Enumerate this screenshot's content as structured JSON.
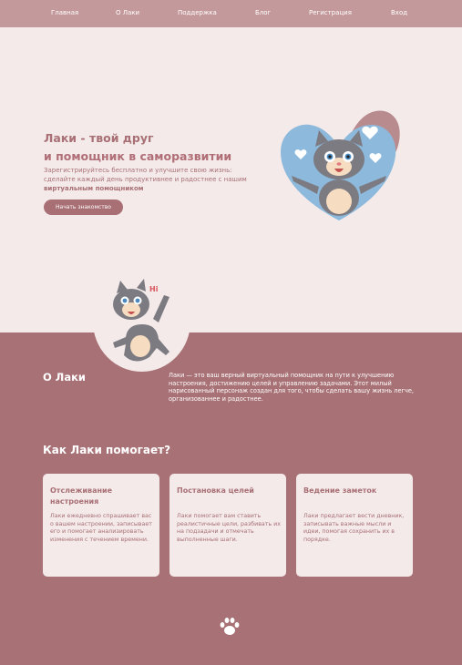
{
  "nav": {
    "items": [
      "Главная",
      "О Лаки",
      "Поддержка",
      "Блог",
      "Регистрация",
      "Вход"
    ]
  },
  "hero": {
    "title_line1": "Лаки - твой друг",
    "title_line2": "и помощник в саморазвитии",
    "subtitle_part1": "Зарегистрируйтесь бесплатно и улучшите свою жизнь: сделайте каждый день продуктивнее и радостнее с нашим ",
    "subtitle_bold": "виртуальным помощником",
    "cta_label": "Начать знакомство"
  },
  "mascot_badge": "Hi",
  "about": {
    "title": "О Лаки",
    "text": "Лаки — это ваш верный виртуальный помощник на пути к улучшению настроения, достижению целей и управлению задачами. Этот милый нарисованный персонаж создан для того, чтобы сделать вашу жизнь легче, организованнее и радостнее."
  },
  "how": {
    "title": "Как Лаки помогает?",
    "cards": [
      {
        "title": "Отслеживание настроения",
        "text": "Лаки ежедневно спрашивает вас о вашем настроении, записывает его и помогает анализировать изменения с течением времени."
      },
      {
        "title": "Постановка целей",
        "text": "Лаки помогает вам ставить реалистичные цели, разбивать их на подзадачи и отмечать выполненные шаги."
      },
      {
        "title": "Ведение заметок",
        "text": "Лаки предлагает вести дневник, записывать важные мысли и идеи, помогая сохранить их в порядке."
      }
    ]
  },
  "colors": {
    "nav_bg": "#c4999b",
    "page_bg": "#f4eaea",
    "accent": "#a86f74",
    "heart_blue": "#8db9dc",
    "heart_back": "#b88c8f"
  },
  "icons": [
    "heart-icon",
    "cat-mascot",
    "paw-icon"
  ]
}
